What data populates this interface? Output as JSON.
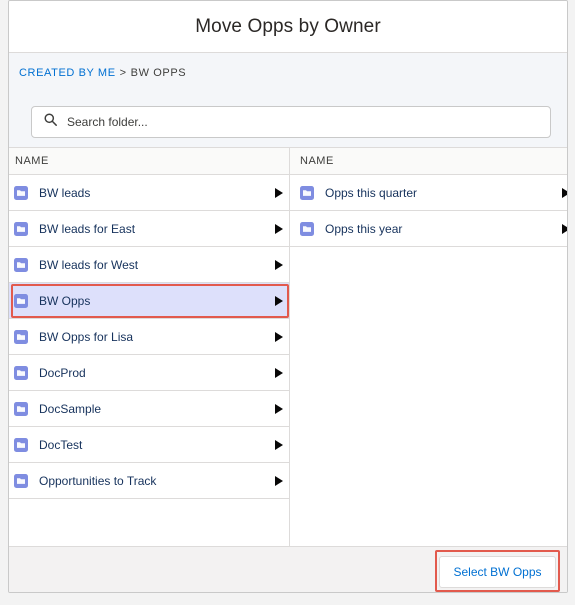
{
  "modal": {
    "title": "Move Opps by Owner"
  },
  "breadcrumb": {
    "link_label": "CREATED BY ME",
    "separator": ">",
    "current": "BW OPPS"
  },
  "search": {
    "placeholder": "Search folder...",
    "value": ""
  },
  "left_column": {
    "header": "NAME",
    "items": [
      {
        "label": "BW leads",
        "selected": false
      },
      {
        "label": "BW leads for East",
        "selected": false
      },
      {
        "label": "BW leads for West",
        "selected": false
      },
      {
        "label": "BW Opps",
        "selected": true
      },
      {
        "label": "BW Opps for Lisa",
        "selected": false
      },
      {
        "label": "DocProd",
        "selected": false
      },
      {
        "label": "DocSample",
        "selected": false
      },
      {
        "label": "DocTest",
        "selected": false
      },
      {
        "label": "Opportunities to Track",
        "selected": false
      }
    ]
  },
  "right_column": {
    "header": "NAME",
    "items": [
      {
        "label": "Opps this quarter"
      },
      {
        "label": "Opps this year"
      }
    ]
  },
  "footer": {
    "select_button_label": "Select BW Opps"
  },
  "icons": {
    "folder": "folder-icon",
    "search": "search-icon",
    "expand": "caret-right-icon"
  },
  "colors": {
    "accent": "#0070d2",
    "folder_icon": "#7f8de1",
    "selected_row": "#dde0fb",
    "highlight_outline": "#e25a4d"
  }
}
